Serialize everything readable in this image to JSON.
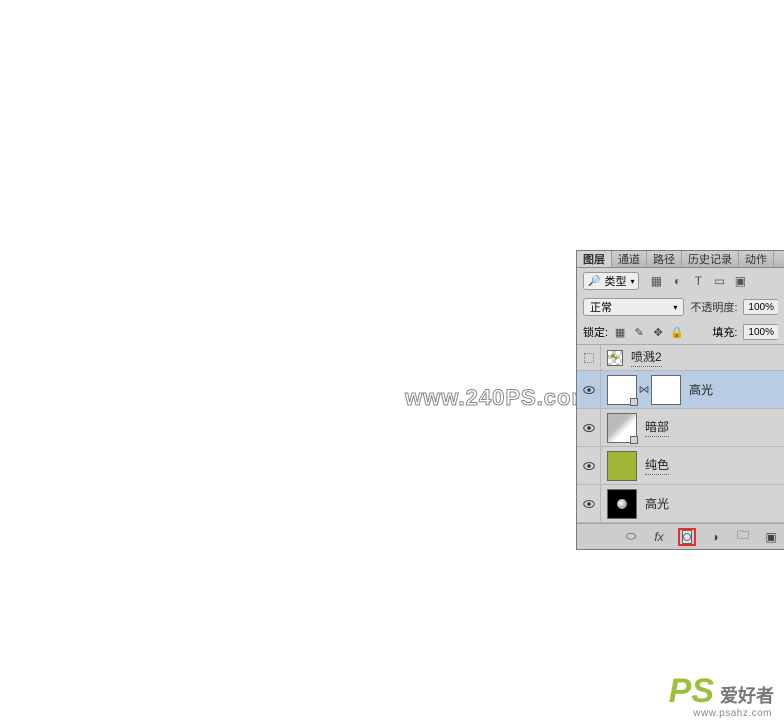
{
  "watermark": "www.240PS.com",
  "panel": {
    "tabs": [
      "图层",
      "通道",
      "路径",
      "历史记录",
      "动作"
    ],
    "active_tab": 0,
    "kind_label": "类型",
    "blend_mode": "正常",
    "opacity_label": "不透明度:",
    "opacity_value": "100%",
    "lock_label": "锁定:",
    "fill_label": "填充:",
    "fill_value": "100%",
    "layers": [
      {
        "name": "喷溅2",
        "visible": false,
        "thumb": "checker",
        "selected": false,
        "small": true
      },
      {
        "name": "高光",
        "visible": true,
        "thumb": "white",
        "mask": "white",
        "linked": true,
        "selected": true,
        "dotted": true
      },
      {
        "name": "暗部",
        "visible": true,
        "thumb": "graymask",
        "selected": false,
        "dotted": true,
        "corner": true
      },
      {
        "name": "纯色",
        "visible": true,
        "thumb": "green",
        "selected": false,
        "dotted": true
      },
      {
        "name": "高光",
        "visible": true,
        "thumb": "black",
        "selected": false
      }
    ]
  },
  "brand": {
    "logo": "PS",
    "cn": "爱好者",
    "url": "www.psahz.com"
  }
}
